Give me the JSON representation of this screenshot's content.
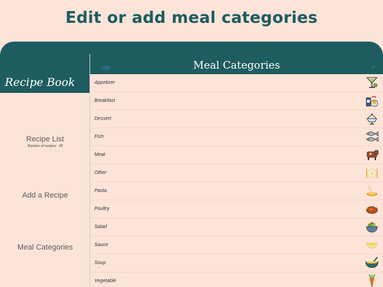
{
  "headline": "Edit or add meal categories",
  "sidebar": {
    "title": "Recipe Book",
    "items": [
      {
        "label": "Recipe List",
        "count_label": "Number of recipes:",
        "count": "49"
      },
      {
        "label": "Add a Recipe"
      },
      {
        "label": "Meal Categories"
      }
    ]
  },
  "detail": {
    "edit_label": "Edit",
    "title": "Meal Categories",
    "add_label": "+",
    "categories": [
      {
        "name": "Appetizer",
        "icon": "cocktail-icon"
      },
      {
        "name": "Breakfast",
        "icon": "breakfast-icon"
      },
      {
        "name": "Dessert",
        "icon": "sundae-icon"
      },
      {
        "name": "Fish",
        "icon": "fish-icon"
      },
      {
        "name": "Meat",
        "icon": "cow-icon"
      },
      {
        "name": "Other",
        "icon": "plate-icon"
      },
      {
        "name": "Pasta",
        "icon": "pasta-icon"
      },
      {
        "name": "Poultry",
        "icon": "roast-chicken-icon"
      },
      {
        "name": "Salad",
        "icon": "salad-bowl-icon"
      },
      {
        "name": "Sauce",
        "icon": "sauce-boat-icon"
      },
      {
        "name": "Soup",
        "icon": "soup-bowl-icon"
      },
      {
        "name": "Vegetable",
        "icon": "carrot-icon"
      }
    ]
  },
  "colors": {
    "teal": "#1e5d5f",
    "background": "#fde4d9",
    "link": "#3b7bc8"
  }
}
